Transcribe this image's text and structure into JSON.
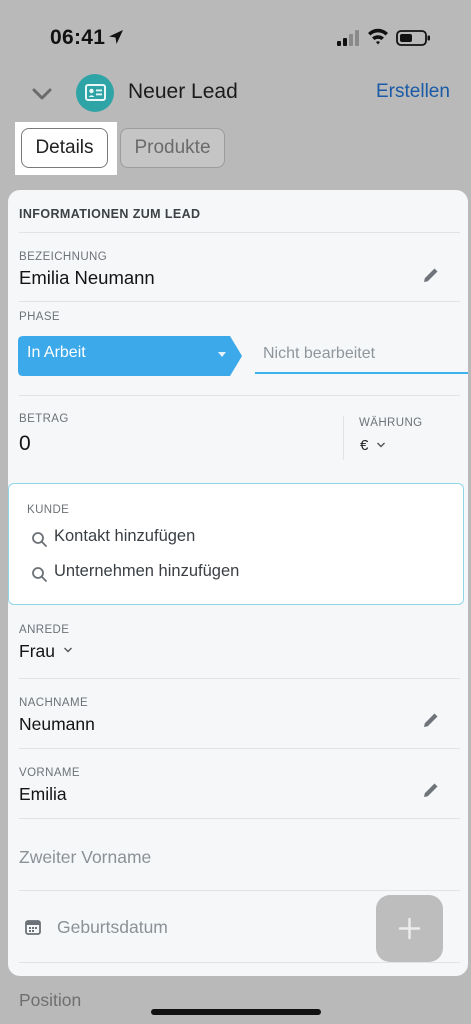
{
  "status": {
    "time": "06:41",
    "location_icon": "location-arrow-icon",
    "signal_icon": "cellular-signal-icon",
    "wifi_icon": "wifi-icon",
    "battery_icon": "battery-icon"
  },
  "header": {
    "title": "Neuer Lead",
    "create_label": "Erstellen",
    "collapse_icon": "chevron-down-icon",
    "app_icon": "lead-card-icon"
  },
  "tabs": [
    {
      "label": "Details",
      "active": true
    },
    {
      "label": "Produkte",
      "active": false
    }
  ],
  "form": {
    "section_title": "INFORMATIONEN ZUM LEAD",
    "bezeichnung": {
      "label": "BEZEICHNUNG",
      "value": "Emilia Neumann"
    },
    "phase": {
      "label": "PHASE",
      "active": "In Arbeit",
      "next": "Nicht bearbeitet"
    },
    "betrag": {
      "label": "BETRAG",
      "value": "0"
    },
    "waehrung": {
      "label": "WÄHRUNG",
      "value": "€"
    },
    "kunde": {
      "label": "KUNDE",
      "add_contact": "Kontakt hinzufügen",
      "add_company": "Unternehmen hinzufügen"
    },
    "anrede": {
      "label": "ANREDE",
      "value": "Frau"
    },
    "nachname": {
      "label": "NACHNAME",
      "value": "Neumann"
    },
    "vorname": {
      "label": "VORNAME",
      "value": "Emilia"
    },
    "zweiter_vorname_placeholder": "Zweiter Vorname",
    "geburtsdatum_placeholder": "Geburtsdatum",
    "position_placeholder": "Position"
  },
  "colors": {
    "accent": "#3ba9ea",
    "link": "#1a5aa6",
    "app_icon_bg": "#2fa4a6",
    "overlay": "#b9b9b9"
  }
}
